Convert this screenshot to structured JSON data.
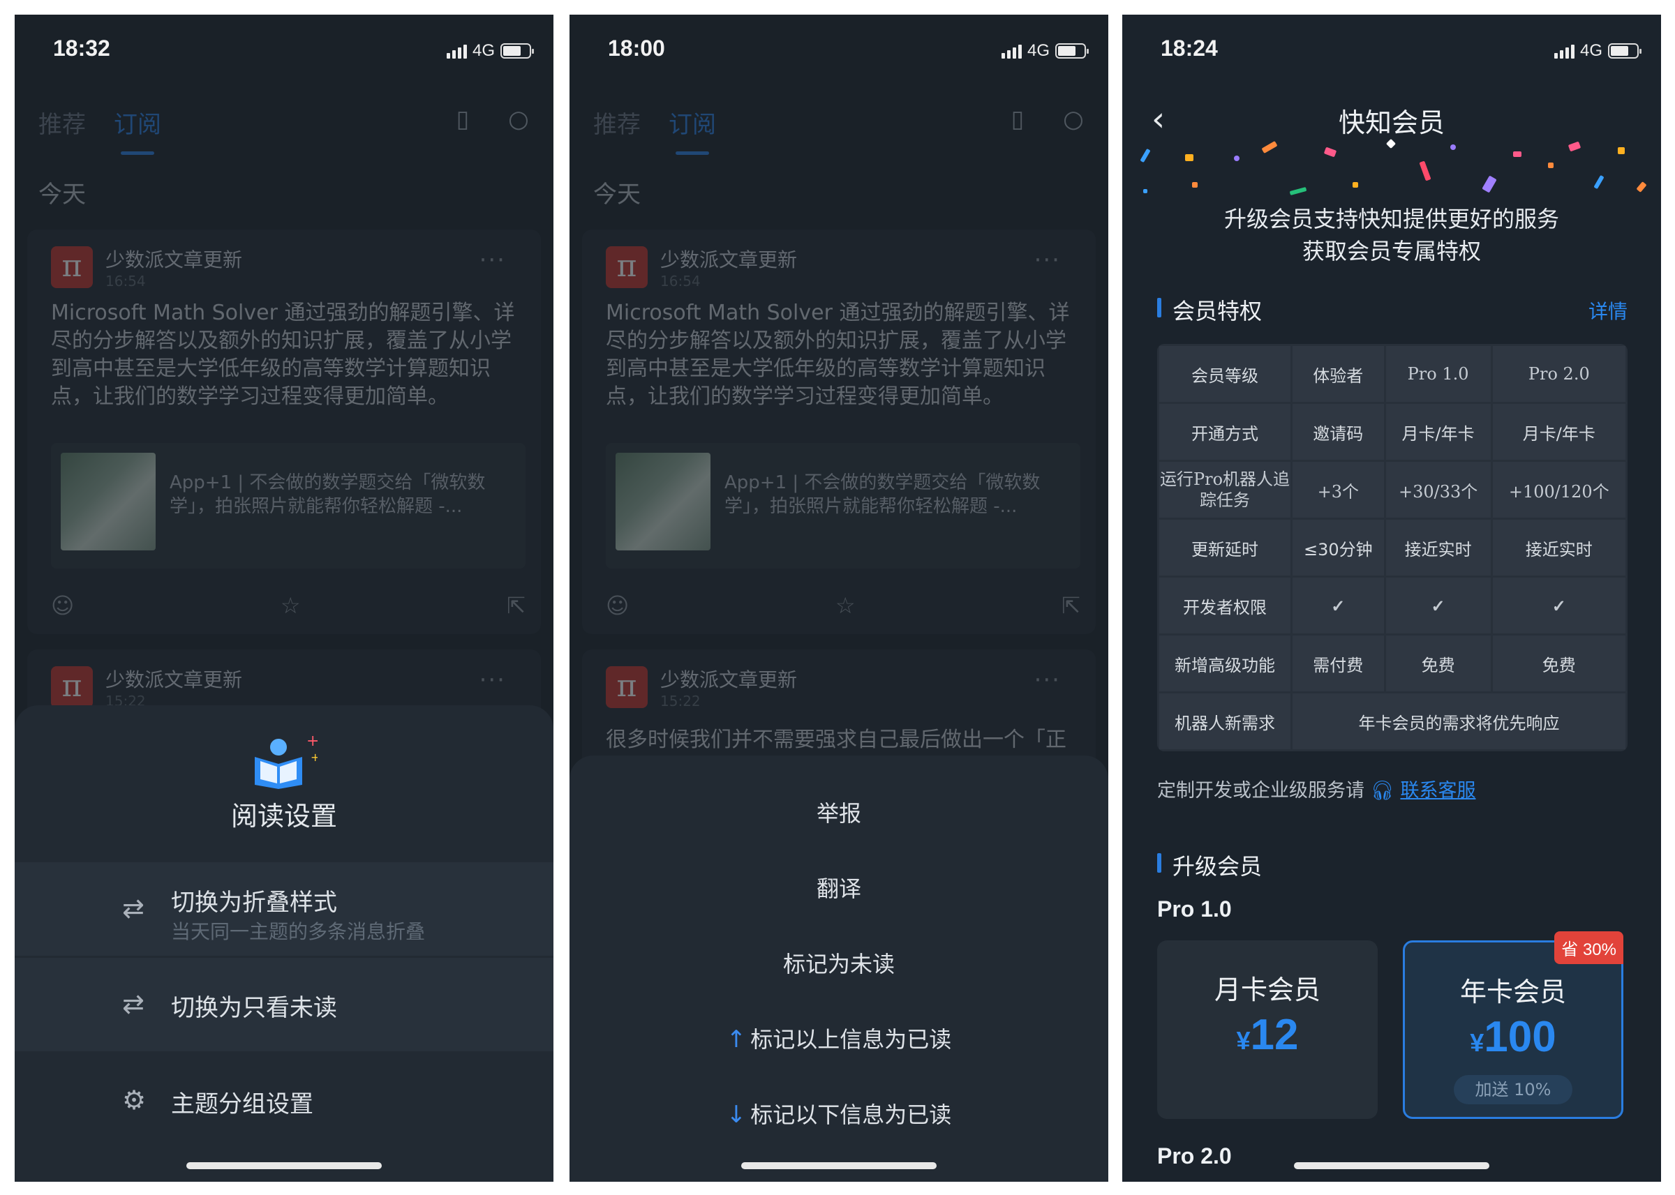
{
  "status": [
    {
      "time": "18:32",
      "network": "4G"
    },
    {
      "time": "18:00",
      "network": "4G"
    },
    {
      "time": "18:24",
      "network": "4G"
    }
  ],
  "feed": {
    "tabs": [
      "推荐",
      "订阅"
    ],
    "today": "今天",
    "post1": {
      "source": "少数派文章更新",
      "time": "16:54",
      "text": "Microsoft Math Solver 通过强劲的解题引擎、详尽的分步解答以及额外的知识扩展，覆盖了从小学到高中甚至是大学低年级的高等数学计算题知识点，让我们的数学学习过程变得更加简单。",
      "link": "App+1 | 不会做的数学题交给「微软数学」，拍张照片就能帮你轻松解题 -..."
    },
    "post2": {
      "source": "少数派文章更新",
      "time": "15:22",
      "text": "很多时候我们并不需要强求自己最后做出一个「正确」的选择，在做决定之前，我们可以先"
    }
  },
  "reading_sheet": {
    "title": "阅读设置",
    "items": [
      {
        "label": "切换为折叠样式",
        "sub": "当天同一主题的多条消息折叠",
        "icon": "swap-icon"
      },
      {
        "label": "切换为只看未读",
        "icon": "swap-icon"
      },
      {
        "label": "主题分组设置",
        "icon": "gear-icon"
      }
    ]
  },
  "context_menu": {
    "items": [
      "举报",
      "翻译",
      "标记为未读",
      "标记以上信息为已读",
      "标记以下信息为已读"
    ]
  },
  "member": {
    "title": "快知会员",
    "hero": [
      "升级会员支持快知提供更好的服务",
      "获取会员专属特权"
    ],
    "privileges_title": "会员特权",
    "details_link": "详情",
    "table": {
      "headers": [
        "会员等级",
        "体验者",
        "Pro 1.0",
        "Pro 2.0"
      ],
      "rows": [
        [
          "开通方式",
          "邀请码",
          "月卡/年卡",
          "月卡/年卡"
        ],
        [
          "运行Pro机器人追踪任务",
          "+3个",
          "+30/33个",
          "+100/120个"
        ],
        [
          "更新延时",
          "≤30分钟",
          "接近实时",
          "接近实时"
        ],
        [
          "开发者权限",
          "✓",
          "✓",
          "✓"
        ],
        [
          "新增高级功能",
          "需付费",
          "免费",
          "免费"
        ]
      ],
      "last_row_label": "机器人新需求",
      "last_row_value": "年卡会员的需求将优先响应"
    },
    "custom_text": "定制开发或企业级服务请",
    "custom_link": "联系客服",
    "upgrade_title": "升级会员",
    "pro1_label": "Pro 1.0",
    "plans": [
      {
        "name": "月卡会员",
        "currency": "¥",
        "price": "12"
      },
      {
        "name": "年卡会员",
        "currency": "¥",
        "price": "100",
        "bonus": "加送 10%",
        "tag": "省 30%"
      }
    ],
    "pro2_label": "Pro 2.0"
  },
  "colors": {
    "accent": "#2a7de0",
    "check": "#26b76a",
    "tag": "#e2433a",
    "bg": "#1a2128"
  }
}
